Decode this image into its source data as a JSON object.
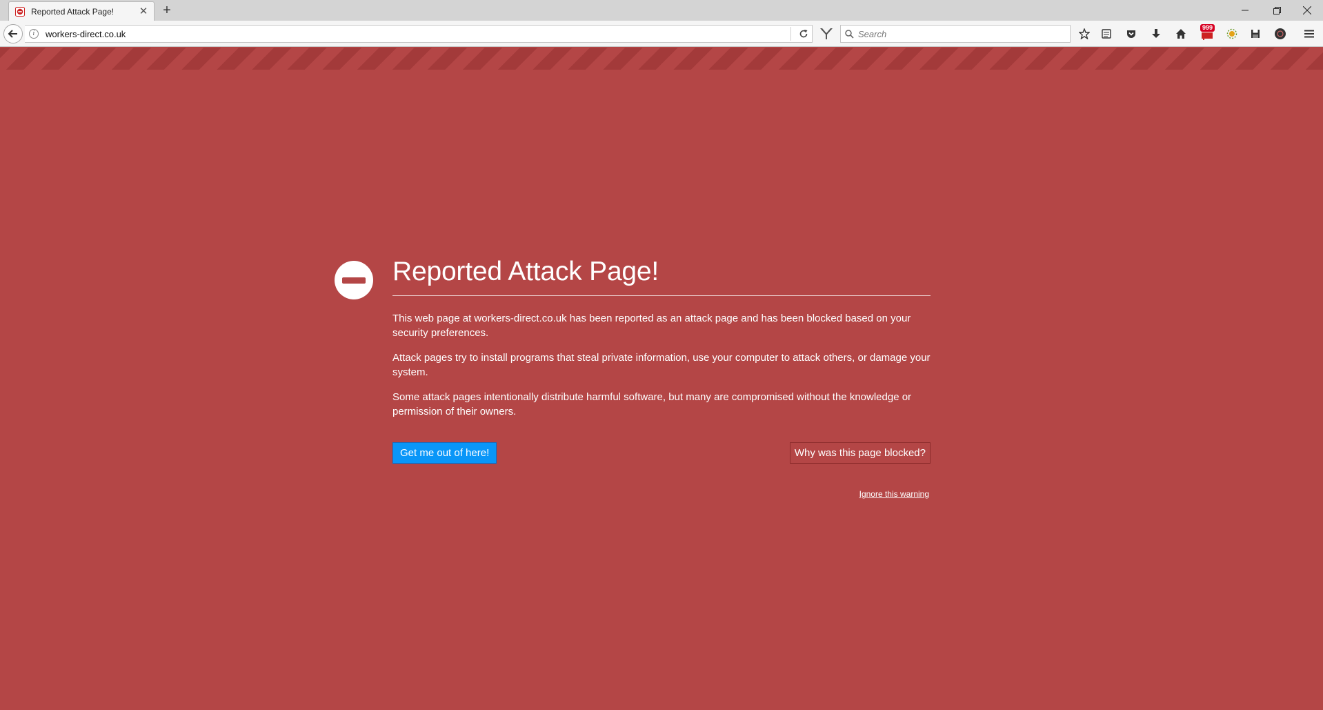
{
  "browser": {
    "tab": {
      "title": "Reported Attack Page!"
    },
    "url": "workers-direct.co.uk",
    "search_placeholder": "Search",
    "notification_count": "999"
  },
  "page": {
    "title": "Reported Attack Page!",
    "paragraphs": [
      "This web page at workers-direct.co.uk has been reported as an attack page and has been blocked based on your security preferences.",
      "Attack pages try to install programs that steal private information, use your computer to attack others, or damage your system.",
      "Some attack pages intentionally distribute harmful software, but many are compromised without the knowledge or permission of their owners."
    ],
    "primary_button": "Get me out of here!",
    "secondary_button": "Why was this page blocked?",
    "ignore_link": "Ignore this warning"
  },
  "colors": {
    "background": "#b44646",
    "primary_button": "#0996f8"
  }
}
